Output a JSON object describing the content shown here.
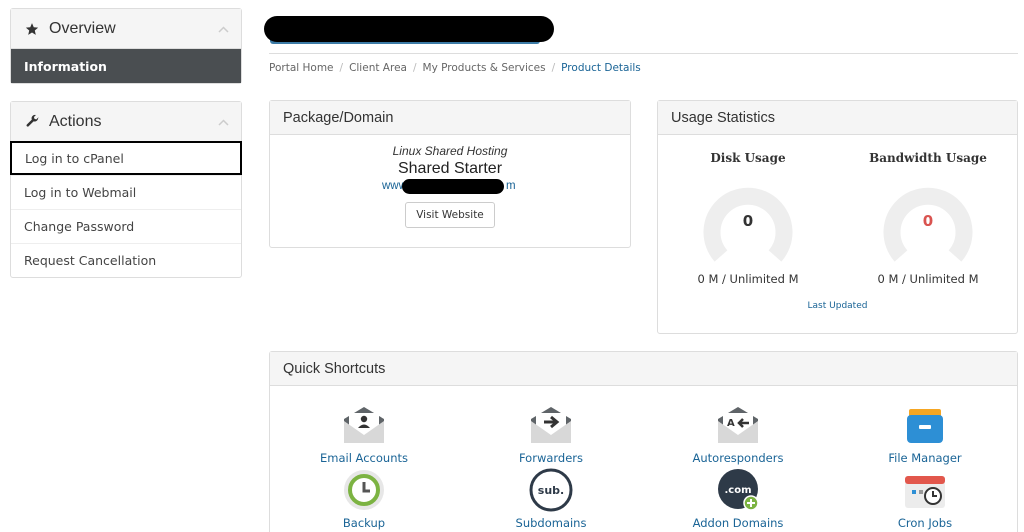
{
  "sidebar": {
    "overview": {
      "title": "Overview",
      "items": [
        {
          "label": "Information"
        }
      ]
    },
    "actions": {
      "title": "Actions",
      "items": [
        {
          "label": "Log in to cPanel"
        },
        {
          "label": "Log in to Webmail"
        },
        {
          "label": "Change Password"
        },
        {
          "label": "Request Cancellation"
        }
      ]
    }
  },
  "breadcrumb": {
    "items": [
      "Portal Home",
      "Client Area",
      "My Products & Services"
    ],
    "current": "Product Details",
    "separator": "/"
  },
  "package_panel": {
    "title": "Package/Domain",
    "type": "Linux Shared Hosting",
    "name": "Shared Starter",
    "domain_prefix": "www",
    "domain_suffix": "m",
    "visit_button": "Visit Website"
  },
  "usage_panel": {
    "title": "Usage Statistics",
    "disk": {
      "label": "Disk Usage",
      "value": "0",
      "text": "0 M / Unlimited M"
    },
    "bandwidth": {
      "label": "Bandwidth Usage",
      "value": "0",
      "text": "0 M / Unlimited M"
    },
    "last_updated": "Last Updated"
  },
  "shortcuts_panel": {
    "title": "Quick Shortcuts",
    "items": [
      {
        "label": "Email Accounts",
        "icon": "email-accounts-icon"
      },
      {
        "label": "Forwarders",
        "icon": "forwarders-icon"
      },
      {
        "label": "Autoresponders",
        "icon": "autoresponders-icon"
      },
      {
        "label": "File Manager",
        "icon": "file-manager-icon"
      },
      {
        "label": "Backup",
        "icon": "backup-icon"
      },
      {
        "label": "Subdomains",
        "icon": "subdomains-icon"
      },
      {
        "label": "Addon Domains",
        "icon": "addon-domains-icon"
      },
      {
        "label": "Cron Jobs",
        "icon": "cron-jobs-icon"
      }
    ]
  },
  "colors": {
    "link": "#1a6496",
    "active_nav_bg": "#4a4e51",
    "panel_head_bg": "#f5f5f5",
    "bandwidth_value": "#d9534f",
    "title_text": "#1a6496"
  }
}
